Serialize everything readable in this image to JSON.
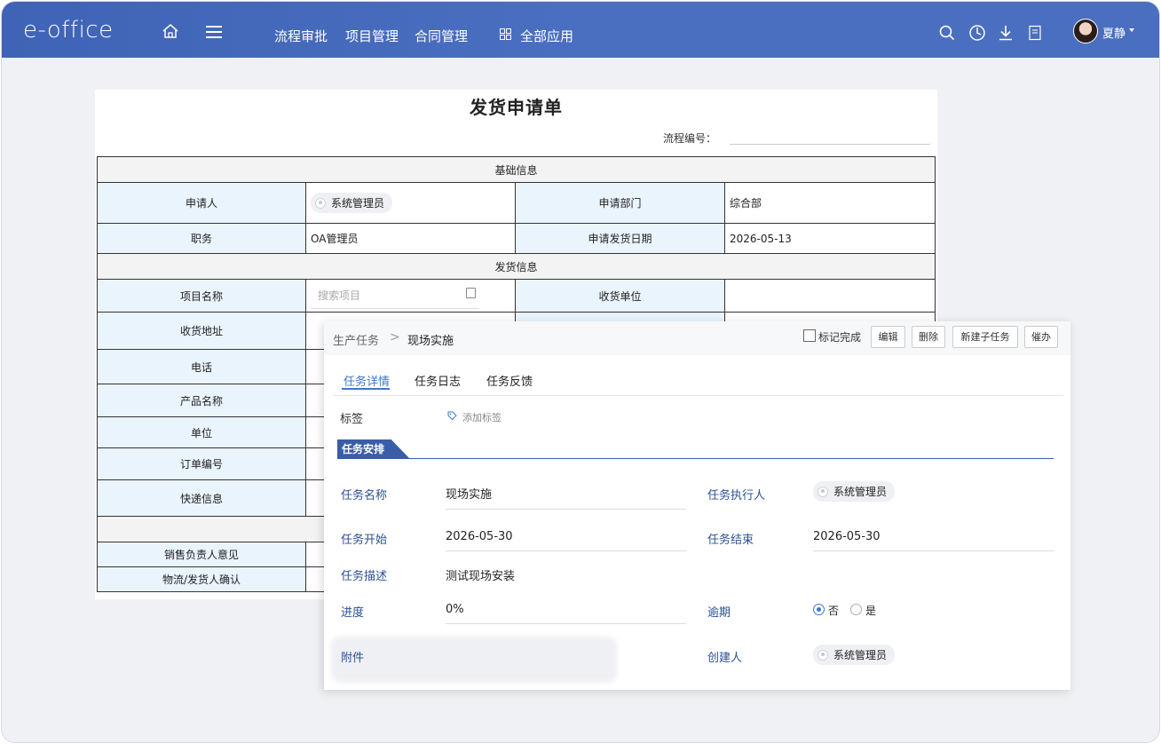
{
  "header": {
    "logo": "e-office",
    "nav": [
      "流程审批",
      "项目管理",
      "合同管理"
    ],
    "all_apps": "全部应用",
    "user": "夏静"
  },
  "form": {
    "title": "发货申请单",
    "flow_no_label": "流程编号：",
    "section_basic": "基础信息",
    "applicant_label": "申请人",
    "applicant_value": "系统管理员",
    "dept_label": "申请部门",
    "dept_value": "综合部",
    "position_label": "职务",
    "position_value": "OA管理员",
    "date_label": "申请发货日期",
    "date_value": "2026-05-13",
    "section_ship": "发货信息",
    "project_label": "项目名称",
    "project_placeholder": "搜索项目",
    "receiver_label": "收货单位",
    "address_label": "收货地址",
    "phone_label": "电话",
    "product_label": "产品名称",
    "unit_label": "单位",
    "order_label": "订单编号",
    "express_label": "快递信息",
    "sales_opinion_label": "销售负责人意见",
    "logistics_confirm_label": "物流/发货人确认"
  },
  "panel": {
    "breadcrumb_parent": "生产任务",
    "breadcrumb_sep": ">",
    "breadcrumb_current": "现场实施",
    "mark_done_label": "标记完成",
    "buttons": [
      "编辑",
      "删除",
      "新建子任务",
      "催办"
    ],
    "tabs": [
      "任务详情",
      "任务日志",
      "任务反馈"
    ],
    "tag_label": "标签",
    "add_tag": "添加标签",
    "section_title": "任务安排",
    "task_name_label": "任务名称",
    "task_name_value": "现场实施",
    "executor_label": "任务执行人",
    "executor_value": "系统管理员",
    "start_label": "任务开始",
    "start_value": "2026-05-30",
    "end_label": "任务结束",
    "end_value": "2026-05-30",
    "desc_label": "任务描述",
    "desc_value": "测试现场安装",
    "progress_label": "进度",
    "progress_value": "0%",
    "overdue_label": "逾期",
    "overdue_no": "否",
    "overdue_yes": "是",
    "attachment_label": "附件",
    "creator_label": "创建人",
    "creator_value": "系统管理员"
  }
}
